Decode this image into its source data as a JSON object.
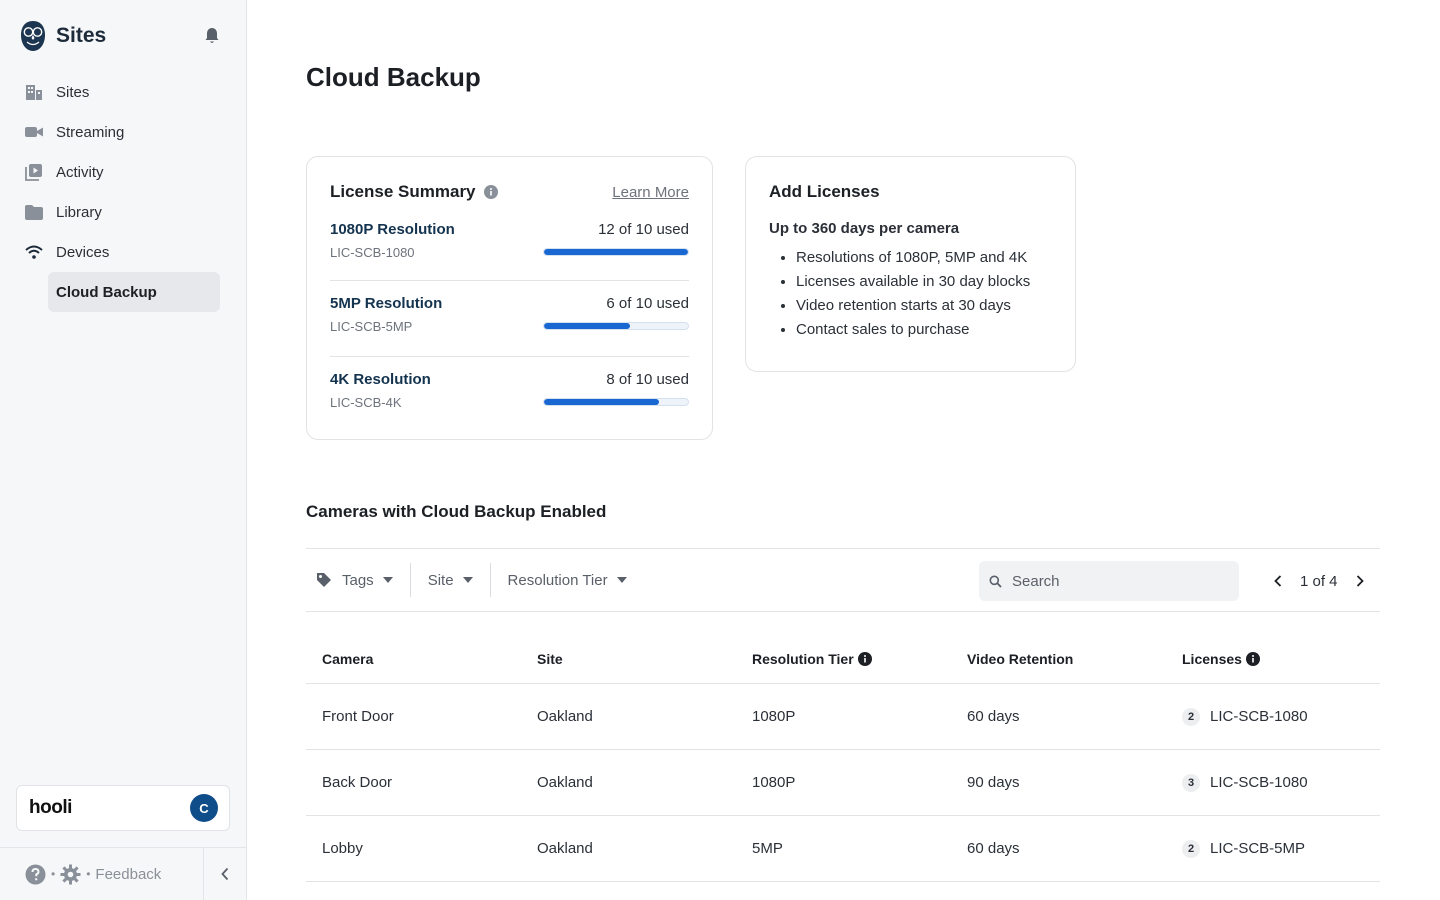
{
  "sidebar": {
    "brand_title": "Sites",
    "items": [
      {
        "label": "Sites",
        "icon": "building-icon"
      },
      {
        "label": "Streaming",
        "icon": "video-camera-icon"
      },
      {
        "label": "Activity",
        "icon": "play-library-icon"
      },
      {
        "label": "Library",
        "icon": "folder-icon"
      },
      {
        "label": "Devices",
        "icon": "wifi-icon"
      }
    ],
    "active_subitem": "Cloud Backup",
    "org_name": "hooli",
    "avatar_initial": "C",
    "feedback_label": "Feedback"
  },
  "page": {
    "title": "Cloud Backup"
  },
  "license_summary": {
    "title": "License Summary",
    "learn_more": "Learn More",
    "rows": [
      {
        "name": "1080P Resolution",
        "code": "LIC-SCB-1080",
        "used_label": "12 of 10 used",
        "used": 12,
        "total": 10
      },
      {
        "name": "5MP Resolution",
        "code": "LIC-SCB-5MP",
        "used_label": "6 of 10 used",
        "used": 6,
        "total": 10
      },
      {
        "name": "4K Resolution",
        "code": "LIC-SCB-4K",
        "used_label": "8 of 10 used",
        "used": 8,
        "total": 10
      }
    ]
  },
  "add_licenses": {
    "title": "Add Licenses",
    "subtitle": "Up to 360 days per camera",
    "bullets": [
      "Resolutions of 1080P, 5MP and 4K",
      "Licenses available in 30 day blocks",
      "Video retention starts at 30 days",
      "Contact sales to purchase"
    ]
  },
  "cameras": {
    "section_title": "Cameras with Cloud Backup Enabled",
    "filters": {
      "tags": "Tags",
      "site": "Site",
      "resolution_tier": "Resolution Tier"
    },
    "search_placeholder": "Search",
    "pager": "1 of 4",
    "columns": [
      "Camera",
      "Site",
      "Resolution Tier",
      "Video Retention",
      "Licenses"
    ],
    "rows": [
      {
        "camera": "Front Door",
        "site": "Oakland",
        "tier": "1080P",
        "retention": "60 days",
        "license_count": "2",
        "license": "LIC-SCB-1080"
      },
      {
        "camera": "Back Door",
        "site": "Oakland",
        "tier": "1080P",
        "retention": "90 days",
        "license_count": "3",
        "license": "LIC-SCB-1080"
      },
      {
        "camera": "Lobby",
        "site": "Oakland",
        "tier": "5MP",
        "retention": "60 days",
        "license_count": "2",
        "license": "LIC-SCB-5MP"
      }
    ]
  },
  "colors": {
    "accent": "#1967d2",
    "avatar": "#0f4d8a",
    "sidebar_bg": "#f6f7f8"
  }
}
